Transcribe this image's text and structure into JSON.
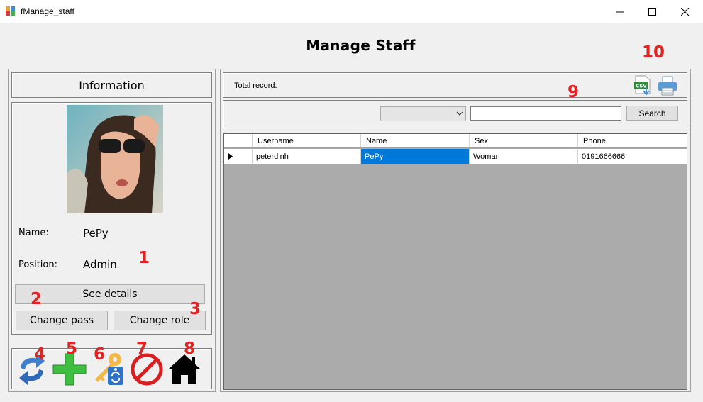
{
  "window": {
    "title": "fManage_staff",
    "controls": [
      "minimize",
      "maximize",
      "close"
    ]
  },
  "page_title": "Manage Staff",
  "info_panel": {
    "header": "Information",
    "name_label": "Name:",
    "name_value": "PePy",
    "position_label": "Position:",
    "position_value": "Admin",
    "see_details": "See details",
    "change_pass": "Change pass",
    "change_role": "Change role"
  },
  "toolbar_icons": [
    "refresh-icon",
    "add-icon",
    "key-tag-icon",
    "block-icon",
    "home-icon"
  ],
  "records": {
    "total_label": "Total record:"
  },
  "search": {
    "filter_value": "",
    "query": "",
    "button": "Search"
  },
  "grid": {
    "columns": [
      "Username",
      "Name",
      "Sex",
      "Phone"
    ],
    "rows": [
      {
        "username": "peterdinh",
        "name": "PePy",
        "sex": "Woman",
        "phone": "0191666666"
      }
    ]
  },
  "annotations": [
    "1",
    "2",
    "3",
    "4",
    "5",
    "6",
    "7",
    "8",
    "9",
    "10"
  ],
  "colors": {
    "selection": "#0078d7",
    "annotation": "#e02424",
    "grid_background": "#ababab"
  }
}
